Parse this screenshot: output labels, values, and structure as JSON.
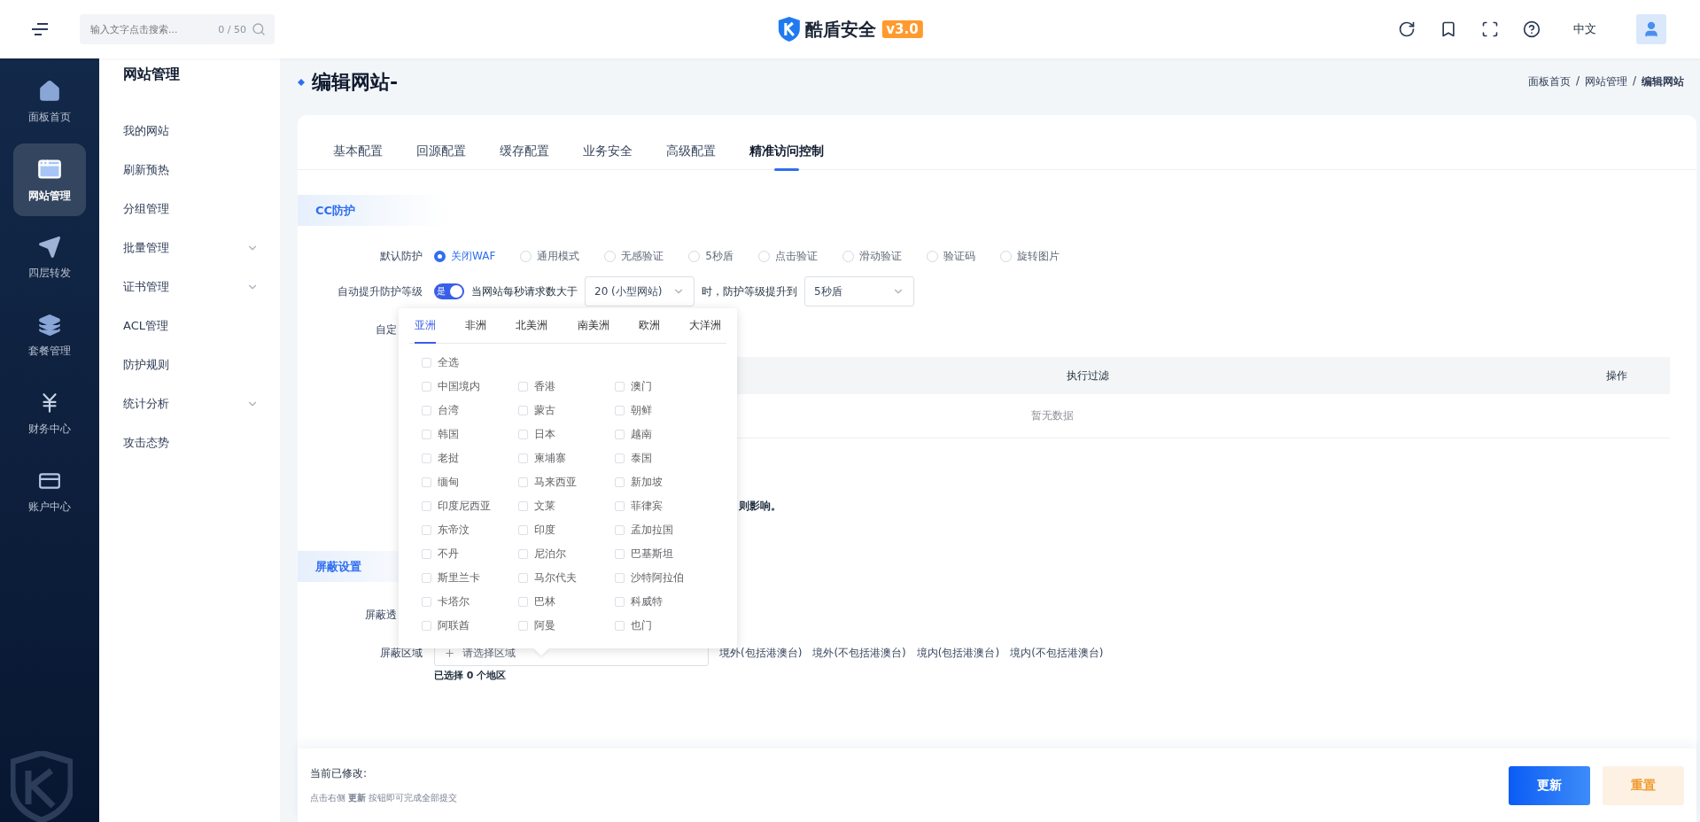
{
  "topbar": {
    "search": {
      "placeholder": "输入文字点击搜索...",
      "counter": "0 / 50"
    },
    "brand": {
      "name": "酷盾安全",
      "version": "v3.0"
    },
    "language": "中文"
  },
  "sidebar": {
    "items": [
      {
        "label": "面板首页",
        "selected": false
      },
      {
        "label": "网站管理",
        "selected": true
      },
      {
        "label": "四层转发",
        "selected": false
      },
      {
        "label": "套餐管理",
        "selected": false
      },
      {
        "label": "财务中心",
        "selected": false
      },
      {
        "label": "账户中心",
        "selected": false
      }
    ]
  },
  "subnav": {
    "title": "网站管理",
    "items": [
      {
        "label": "我的网站",
        "expandable": false
      },
      {
        "label": "刷新预热",
        "expandable": false
      },
      {
        "label": "分组管理",
        "expandable": false
      },
      {
        "label": "批量管理",
        "expandable": true
      },
      {
        "label": "证书管理",
        "expandable": true
      },
      {
        "label": "ACL管理",
        "expandable": false
      },
      {
        "label": "防护规则",
        "expandable": false
      },
      {
        "label": "统计分析",
        "expandable": true
      },
      {
        "label": "攻击态势",
        "expandable": false
      }
    ]
  },
  "page": {
    "title": "编辑网站-",
    "breadcrumb": [
      {
        "kind": "link",
        "text": "面板首页"
      },
      {
        "kind": "separator",
        "text": "/"
      },
      {
        "kind": "link",
        "text": "网站管理"
      },
      {
        "kind": "separator",
        "text": "/"
      },
      {
        "kind": "current",
        "text": "编辑网站"
      }
    ]
  },
  "tabs": [
    {
      "label": "基本配置",
      "selected": false
    },
    {
      "label": "回源配置",
      "selected": false
    },
    {
      "label": "缓存配置",
      "selected": false
    },
    {
      "label": "业务安全",
      "selected": false
    },
    {
      "label": "高级配置",
      "selected": false
    },
    {
      "label": "精准访问控制",
      "selected": true
    }
  ],
  "cc": {
    "title": "CC防护",
    "default_protection": {
      "label": "默认防护",
      "options": [
        {
          "label": "关闭WAF",
          "selected": true
        },
        {
          "label": "通用模式",
          "selected": false
        },
        {
          "label": "无感验证",
          "selected": false
        },
        {
          "label": "5秒盾",
          "selected": false
        },
        {
          "label": "点击验证",
          "selected": false
        },
        {
          "label": "滑动验证",
          "selected": false
        },
        {
          "label": "验证码",
          "selected": false
        },
        {
          "label": "旋转图片",
          "selected": false
        }
      ]
    },
    "auto_upgrade": {
      "label": "自动提升防护等级",
      "toggle": {
        "on": true,
        "text": "是"
      },
      "text_before": "当网站每秒请求数大于",
      "threshold": "20 (小型网站)",
      "text_after": "时，防护等级提升到",
      "level": "5秒盾"
    },
    "custom": {
      "label": "自定"
    },
    "table": {
      "columns": [
        "执行过滤",
        "操作"
      ],
      "empty": "暂无数据"
    },
    "note": "则影响。"
  },
  "block": {
    "title": "屏蔽设置",
    "transparent": {
      "label": "屏蔽透"
    },
    "region": {
      "label": "屏蔽区域",
      "placeholder": "请选择区域",
      "quick": [
        "境外(包括港澳台)",
        "境外(不包括港澳台)",
        "境内(包括港澳台)",
        "境内(不包括港澳台)"
      ],
      "hint": "已选择 0 个地区"
    }
  },
  "region_popup": {
    "tabs": [
      {
        "label": "亚洲",
        "selected": true
      },
      {
        "label": "非洲",
        "selected": false
      },
      {
        "label": "北美洲",
        "selected": false
      },
      {
        "label": "南美洲",
        "selected": false
      },
      {
        "label": "欧洲",
        "selected": false
      },
      {
        "label": "大洋洲",
        "selected": false
      }
    ],
    "select_all": {
      "label": "全选",
      "checked": false
    },
    "regions": [
      {
        "label": "中国境内",
        "checked": false
      },
      {
        "label": "香港",
        "checked": false
      },
      {
        "label": "澳门",
        "checked": false
      },
      {
        "label": "台湾",
        "checked": false
      },
      {
        "label": "蒙古",
        "checked": false
      },
      {
        "label": "朝鲜",
        "checked": false
      },
      {
        "label": "韩国",
        "checked": false
      },
      {
        "label": "日本",
        "checked": false
      },
      {
        "label": "越南",
        "checked": false
      },
      {
        "label": "老挝",
        "checked": false
      },
      {
        "label": "柬埔寨",
        "checked": false
      },
      {
        "label": "泰国",
        "checked": false
      },
      {
        "label": "缅甸",
        "checked": false
      },
      {
        "label": "马来西亚",
        "checked": false
      },
      {
        "label": "新加坡",
        "checked": false
      },
      {
        "label": "印度尼西亚",
        "checked": false
      },
      {
        "label": "文莱",
        "checked": false
      },
      {
        "label": "菲律宾",
        "checked": false
      },
      {
        "label": "东帝汶",
        "checked": false
      },
      {
        "label": "印度",
        "checked": false
      },
      {
        "label": "孟加拉国",
        "checked": false
      },
      {
        "label": "不丹",
        "checked": false
      },
      {
        "label": "尼泊尔",
        "checked": false
      },
      {
        "label": "巴基斯坦",
        "checked": false
      },
      {
        "label": "斯里兰卡",
        "checked": false
      },
      {
        "label": "马尔代夫",
        "checked": false
      },
      {
        "label": "沙特阿拉伯",
        "checked": false
      },
      {
        "label": "卡塔尔",
        "checked": false
      },
      {
        "label": "巴林",
        "checked": false
      },
      {
        "label": "科威特",
        "checked": false
      },
      {
        "label": "阿联酋",
        "checked": false
      },
      {
        "label": "阿曼",
        "checked": false
      },
      {
        "label": "也门",
        "checked": false
      }
    ]
  },
  "footer": {
    "status": "当前已修改:",
    "hint": "点击右侧 **更新** 按钮即可完成全部提交",
    "buttons": [
      {
        "label": "更新",
        "kind": "primary"
      },
      {
        "label": "重置",
        "kind": "reset"
      }
    ]
  }
}
